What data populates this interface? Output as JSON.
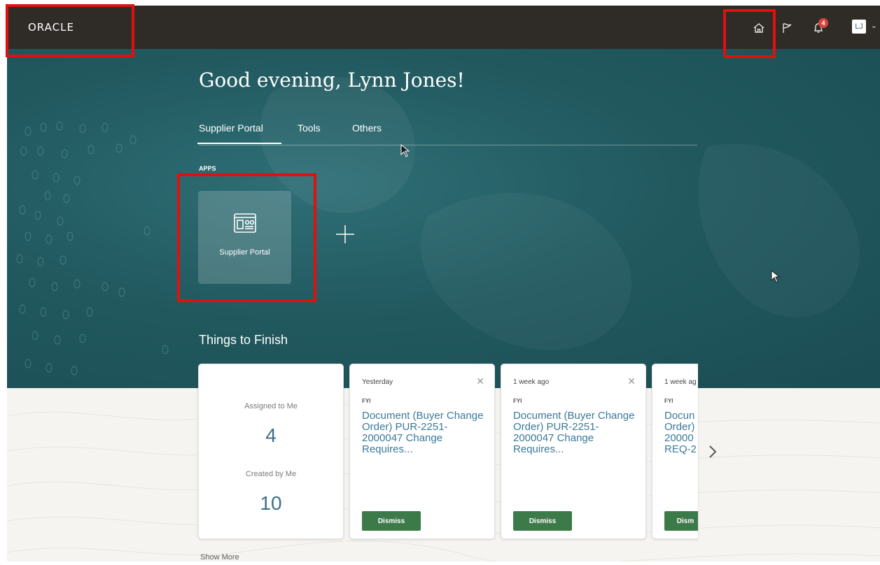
{
  "brand": {
    "logo_text": "ORACLE"
  },
  "header": {
    "notification_count": "4",
    "user_initials": "LJ"
  },
  "greeting": "Good evening, Lynn Jones!",
  "tabs": [
    {
      "label": "Supplier Portal",
      "active": true
    },
    {
      "label": "Tools",
      "active": false
    },
    {
      "label": "Others",
      "active": false
    }
  ],
  "apps": {
    "section_label": "APPS",
    "items": [
      {
        "label": "Supplier Portal",
        "icon": "supplier-portal-icon"
      }
    ]
  },
  "things_to_finish": {
    "title": "Things to Finish",
    "summary": {
      "assigned_label": "Assigned to Me",
      "assigned_count": "4",
      "created_label": "Created by Me",
      "created_count": "10"
    },
    "notifications": [
      {
        "when": "Yesterday",
        "type": "FYI",
        "title": "Document (Buyer Change Order) PUR-2251-2000047 Change Requires...",
        "action": "Dismiss"
      },
      {
        "when": "1 week ago",
        "type": "FYI",
        "title": "Document (Buyer Change Order) PUR-2251-2000047 Change Requires...",
        "action": "Dismiss"
      },
      {
        "when": "1 week ag",
        "type": "FYI",
        "title": "Docun Order) 20000 REQ-2",
        "action": "Dism"
      }
    ],
    "show_more": "Show More"
  },
  "colors": {
    "topbar": "#2f2b27",
    "hero": "#21595f",
    "link": "#3b7a9a",
    "dismiss": "#3d7a4a",
    "highlight": "#e01010"
  }
}
